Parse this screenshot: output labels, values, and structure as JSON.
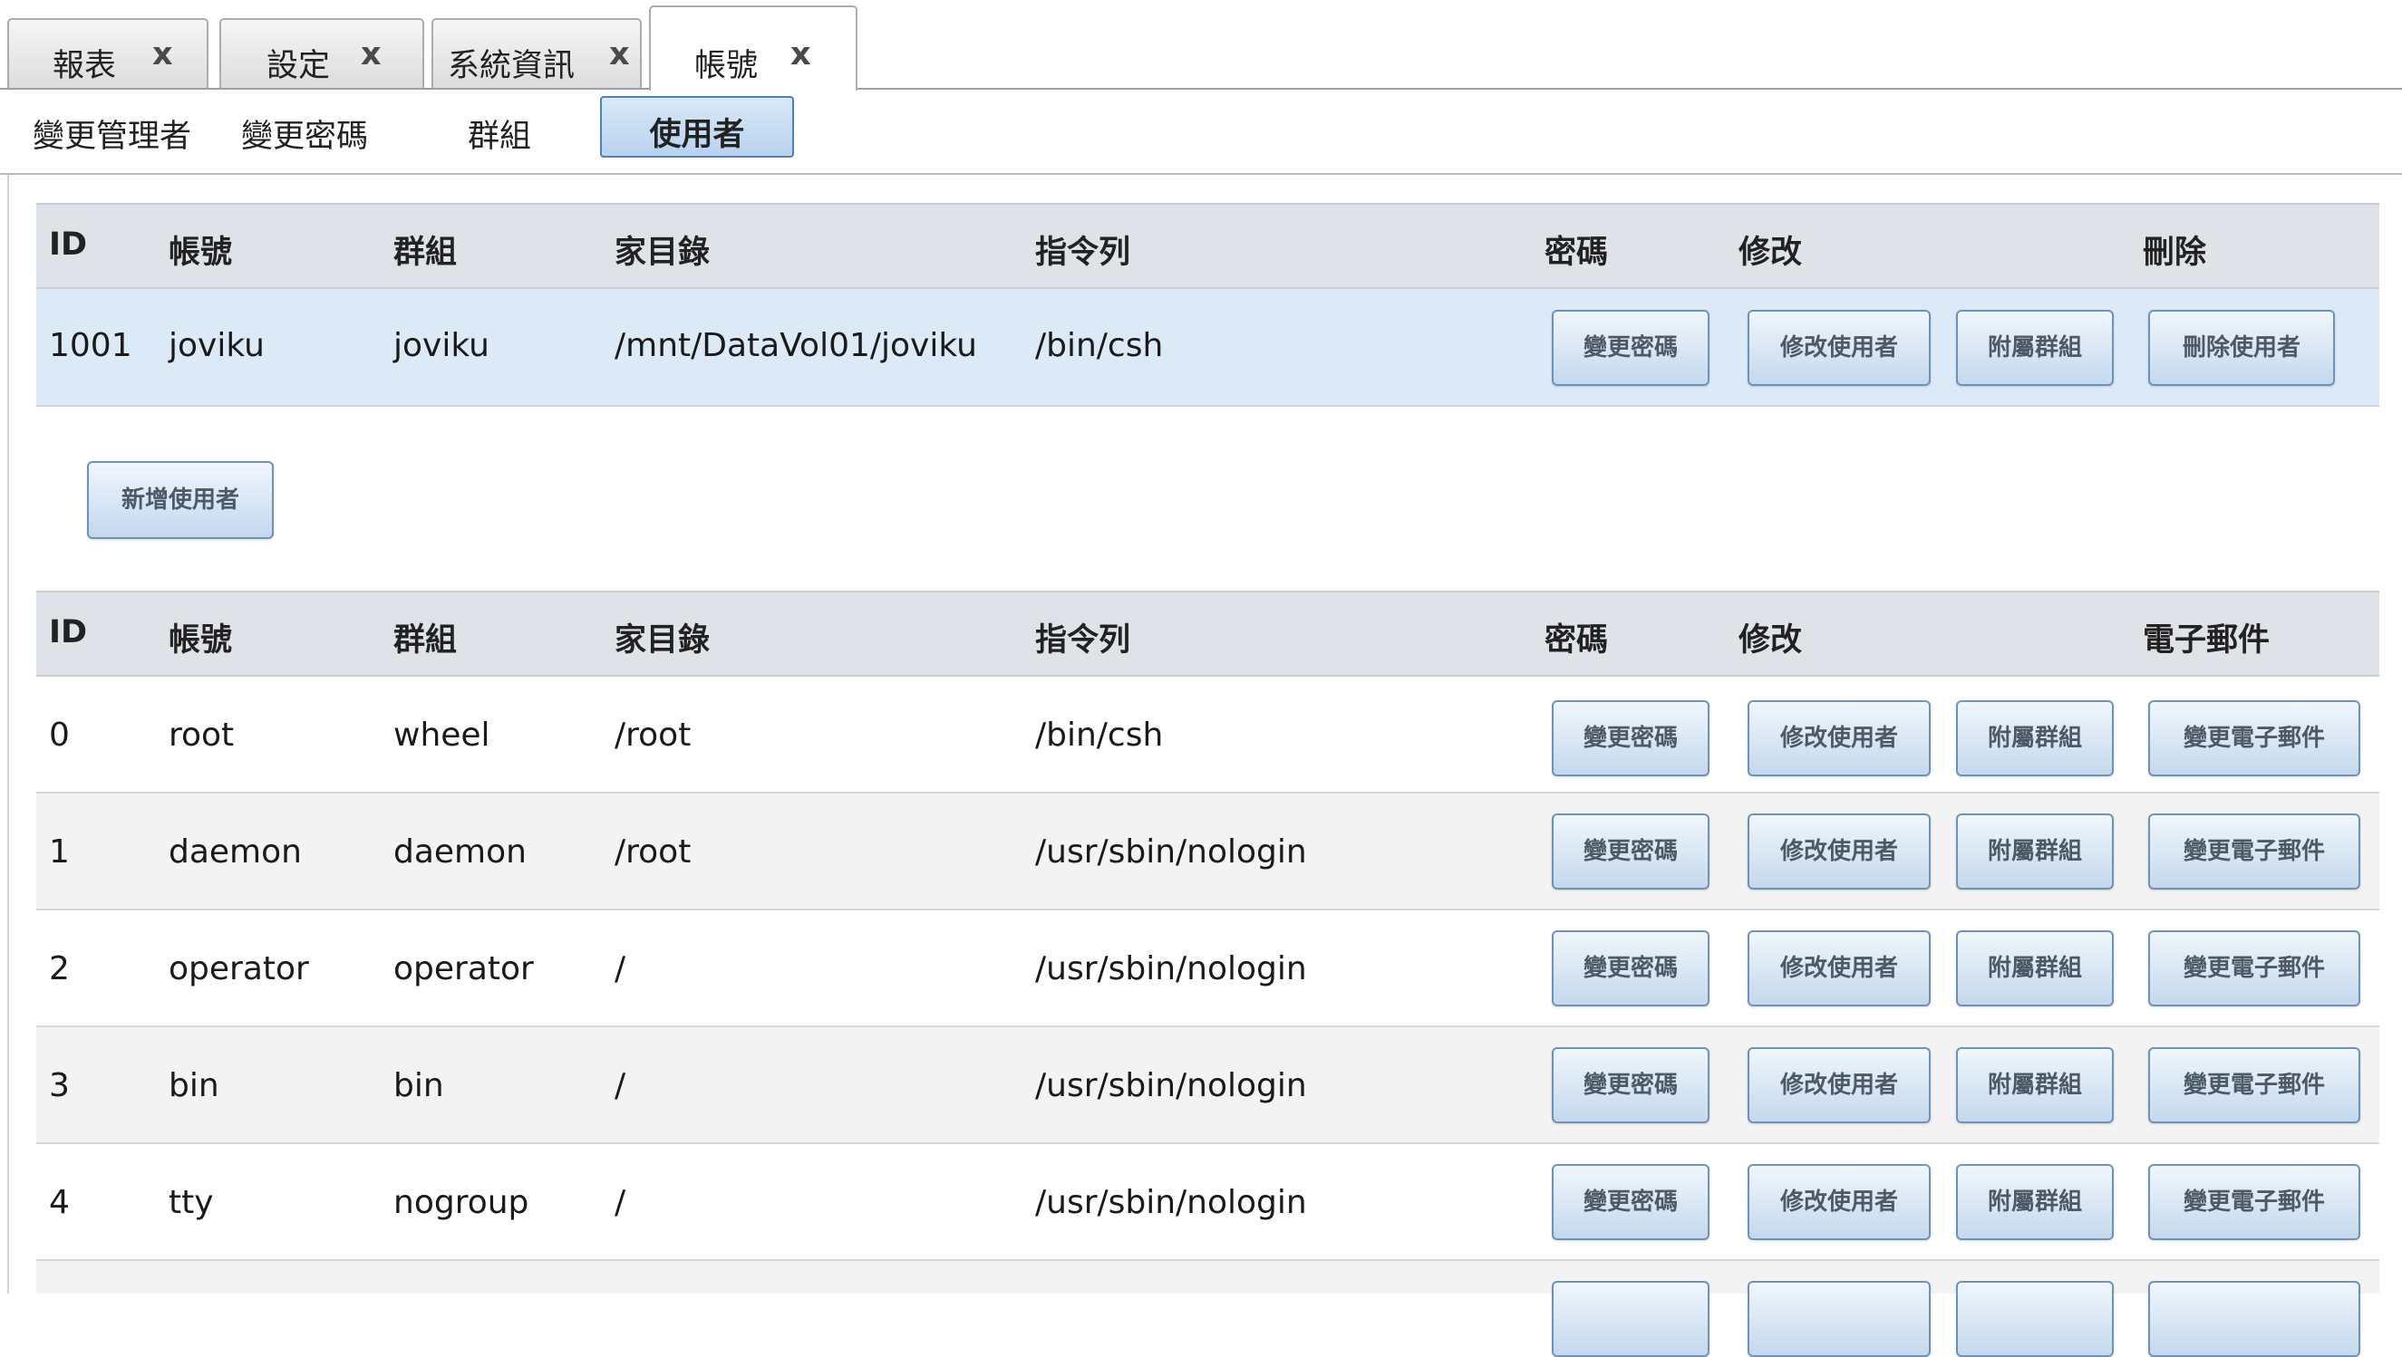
{
  "tabs": [
    {
      "label": "報表",
      "close": "x"
    },
    {
      "label": "設定",
      "close": "x"
    },
    {
      "label": "系統資訊",
      "close": "x"
    },
    {
      "label": "帳號",
      "close": "x"
    }
  ],
  "subnav": {
    "items": [
      "變更管理者",
      "變更密碼",
      "群組",
      "使用者"
    ],
    "active": "使用者"
  },
  "table1": {
    "headers": {
      "id": "ID",
      "account": "帳號",
      "group": "群組",
      "home": "家目錄",
      "shell": "指令列",
      "password": "密碼",
      "modify": "修改",
      "extra": "刪除"
    },
    "row": {
      "id": "1001",
      "account": "joviku",
      "group": "joviku",
      "home": "/mnt/DataVol01/joviku",
      "shell": "/bin/csh",
      "btn_password": "變更密碼",
      "btn_modify": "修改使用者",
      "btn_groups": "附屬群組",
      "btn_delete": "刪除使用者"
    }
  },
  "add_user_button": "新增使用者",
  "table2": {
    "headers": {
      "id": "ID",
      "account": "帳號",
      "group": "群組",
      "home": "家目錄",
      "shell": "指令列",
      "password": "密碼",
      "modify": "修改",
      "extra": "電子郵件"
    },
    "buttons": {
      "password": "變更密碼",
      "modify": "修改使用者",
      "groups": "附屬群組",
      "email": "變更電子郵件"
    },
    "rows": [
      {
        "id": "0",
        "account": "root",
        "group": "wheel",
        "home": "/root",
        "shell": "/bin/csh"
      },
      {
        "id": "1",
        "account": "daemon",
        "group": "daemon",
        "home": "/root",
        "shell": "/usr/sbin/nologin"
      },
      {
        "id": "2",
        "account": "operator",
        "group": "operator",
        "home": "/",
        "shell": "/usr/sbin/nologin"
      },
      {
        "id": "3",
        "account": "bin",
        "group": "bin",
        "home": "/",
        "shell": "/usr/sbin/nologin"
      },
      {
        "id": "4",
        "account": "tty",
        "group": "nogroup",
        "home": "/",
        "shell": "/usr/sbin/nologin"
      }
    ]
  },
  "colors": {
    "header_bg": "#dfe3e7",
    "selected_row": "#dce9f7",
    "button_border": "#6f93b8"
  }
}
